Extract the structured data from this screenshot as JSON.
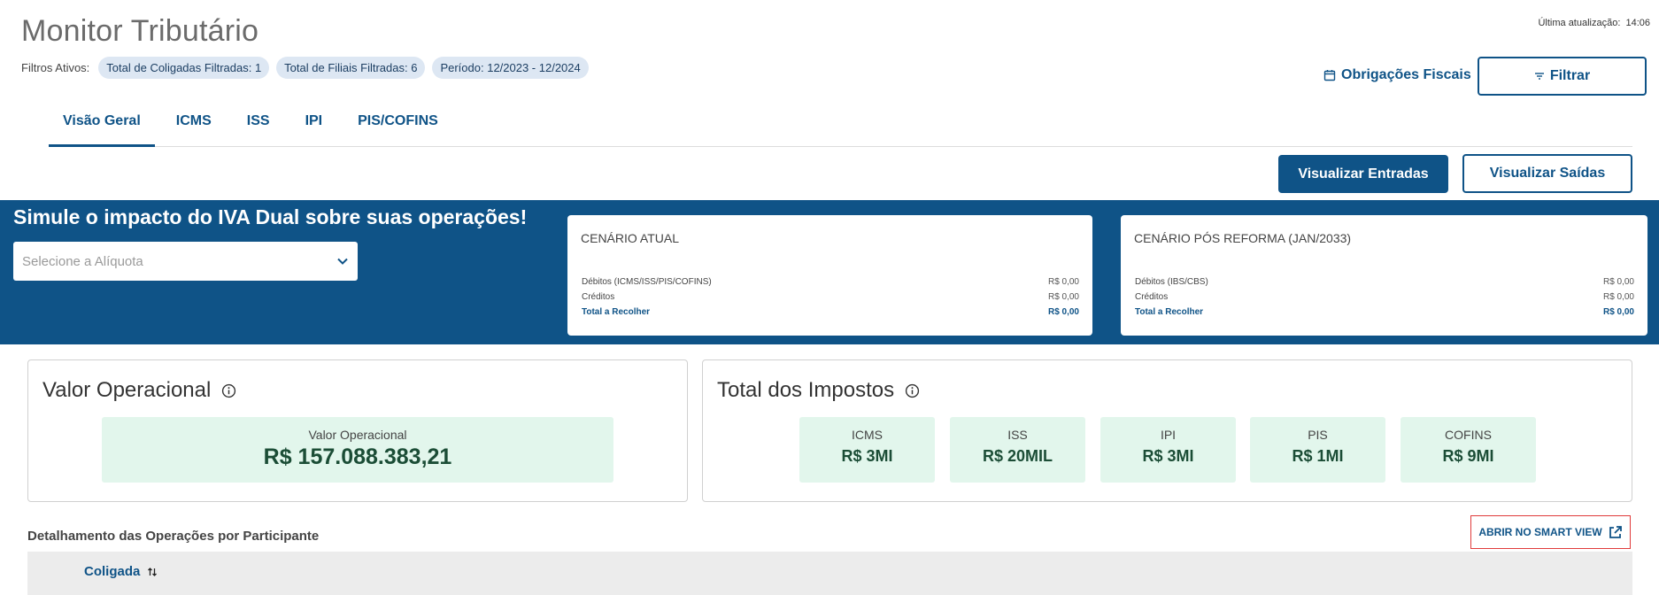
{
  "header": {
    "title": "Monitor Tributário",
    "last_update_label": "Última atualização:",
    "last_update_time": "14:06"
  },
  "filters": {
    "label": "Filtros Ativos:",
    "chips": [
      "Total de Coligadas Filtradas: 1",
      "Total de Filiais Filtradas: 6",
      "Período: 12/2023 - 12/2024"
    ]
  },
  "actions": {
    "obligations_label": "Obrigações Fiscais",
    "filter_label": "Filtrar",
    "view_entries_label": "Visualizar Entradas",
    "view_outputs_label": "Visualizar Saídas"
  },
  "tabs": [
    {
      "label": "Visão Geral",
      "active": true
    },
    {
      "label": "ICMS",
      "active": false
    },
    {
      "label": "ISS",
      "active": false
    },
    {
      "label": "IPI",
      "active": false
    },
    {
      "label": "PIS/COFINS",
      "active": false
    }
  ],
  "banner": {
    "title": "Simule o impacto do IVA Dual sobre suas operações!",
    "select_placeholder": "Selecione a Alíquota",
    "current": {
      "title": "CENÁRIO ATUAL",
      "rows": [
        {
          "label": "Débitos (ICMS/ISS/PIS/COFINS)",
          "value": "R$ 0,00"
        },
        {
          "label": "Créditos",
          "value": "R$ 0,00"
        },
        {
          "label": "Total a Recolher",
          "value": "R$ 0,00"
        }
      ]
    },
    "reform": {
      "title": "CENÁRIO PÓS REFORMA (JAN/2033)",
      "rows": [
        {
          "label": "Débitos (IBS/CBS)",
          "value": "R$ 0,00"
        },
        {
          "label": "Créditos",
          "value": "R$ 0,00"
        },
        {
          "label": "Total a Recolher",
          "value": "R$ 0,00"
        }
      ]
    }
  },
  "operational": {
    "title": "Valor Operacional",
    "metric_label": "Valor Operacional",
    "metric_value": "R$ 157.088.383,21"
  },
  "taxes": {
    "title": "Total dos Impostos",
    "items": [
      {
        "label": "ICMS",
        "value": "R$ 3MI"
      },
      {
        "label": "ISS",
        "value": "R$ 20MIL"
      },
      {
        "label": "IPI",
        "value": "R$ 3MI"
      },
      {
        "label": "PIS",
        "value": "R$ 1MI"
      },
      {
        "label": "COFINS",
        "value": "R$ 9MI"
      }
    ]
  },
  "detail": {
    "title": "Detalhamento das Operações por Participante",
    "smart_view_label": "ABRIR NO SMART VIEW",
    "column_header": "Coligada"
  },
  "colors": {
    "primary": "#0f5387",
    "metric_bg": "#e2f6ec",
    "chip_bg": "#dde7f3",
    "highlight_border": "#e03b3b"
  }
}
